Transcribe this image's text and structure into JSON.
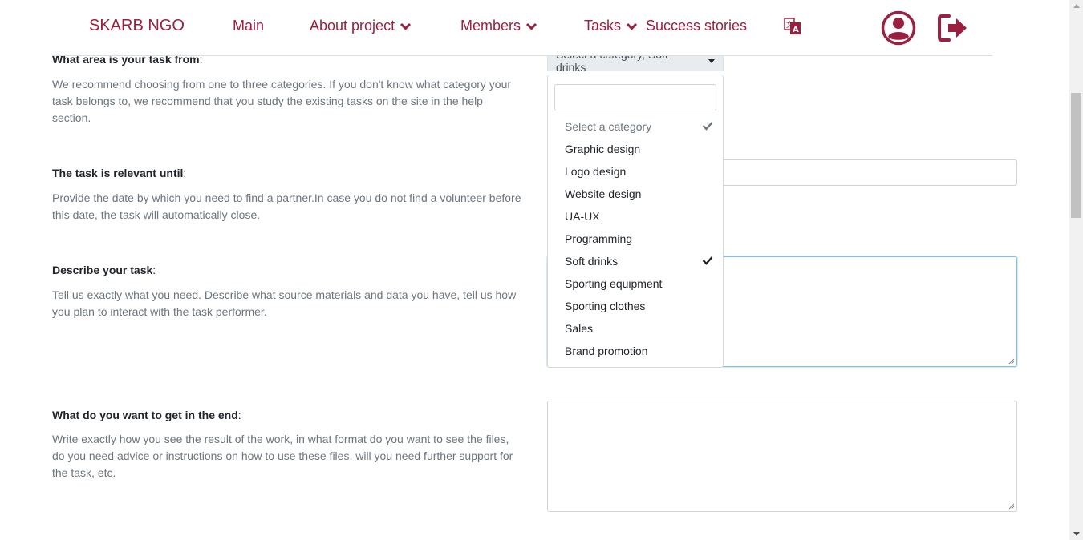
{
  "nav": {
    "brand": "SKARB NGO",
    "items": [
      {
        "label": "Main"
      },
      {
        "label": "About project"
      },
      {
        "label": "Members"
      },
      {
        "label": "Tasks"
      },
      {
        "label": "Success stories"
      }
    ],
    "icons": {
      "translate": "translate-icon",
      "user": "user-account-icon",
      "logout": "logout-icon"
    }
  },
  "form": {
    "category": {
      "title": "What area is your task from",
      "colon": ":",
      "description": "We recommend choosing from one to three categories. If you don't know what category your task belongs to, we recommend that you study the existing tasks on the site in the help section.",
      "selected_text": "Select a category, Soft drinks",
      "search_value": "",
      "options": [
        {
          "label": "Select a category",
          "checked": true,
          "placeholder": true
        },
        {
          "label": "Graphic design",
          "checked": false
        },
        {
          "label": "Logo design",
          "checked": false
        },
        {
          "label": "Website design",
          "checked": false
        },
        {
          "label": "UA-UX",
          "checked": false
        },
        {
          "label": "Programming",
          "checked": false
        },
        {
          "label": "Soft drinks",
          "checked": true
        },
        {
          "label": "Sporting equipment",
          "checked": false
        },
        {
          "label": "Sporting clothes",
          "checked": false
        },
        {
          "label": "Sales",
          "checked": false
        },
        {
          "label": "Brand promotion",
          "checked": false
        }
      ]
    },
    "relevant_until": {
      "title": "The task is relevant until",
      "colon": ":",
      "description": "Provide the date by which you need to find a partner.In case you do not find a volunteer before this date, the task will automatically close.",
      "value": ""
    },
    "describe": {
      "title": "Describe your task",
      "colon": ":",
      "description": "Tell us exactly what you need. Describe what source materials and data you have, tell us how you plan to interact with the task performer.",
      "value": ""
    },
    "result": {
      "title": "What do you want to get in the end",
      "colon": ":",
      "description": "Write exactly how you see the result of the work, in what format do you want to see the files, do you need advice or instructions on how to use these files, will you need further support for the task, etc.",
      "value": ""
    }
  },
  "colors": {
    "brand": "#9b2040",
    "muted_text": "#6c757d",
    "focus_border": "#80bdff"
  }
}
